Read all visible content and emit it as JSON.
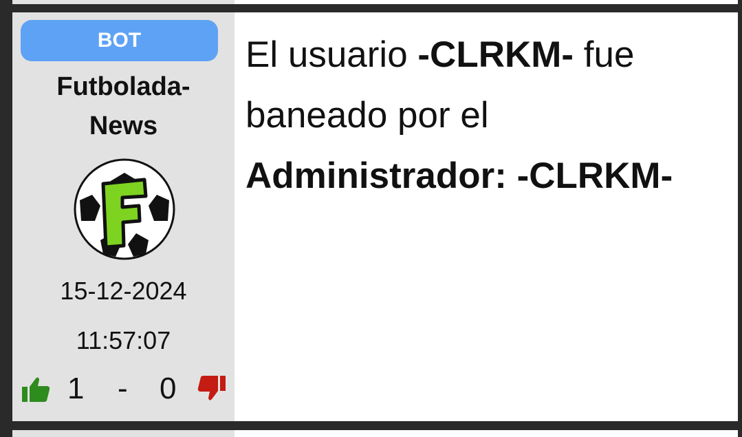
{
  "post": {
    "badge": "BOT",
    "author_line1": "Futbolada-",
    "author_line2": "News",
    "avatar_icon": "soccer-ball-letter-f-icon",
    "avatar_letter": "F",
    "date": "15-12-2024",
    "time": "11:57:07",
    "likes": "1",
    "vote_separator": "-",
    "dislikes": "0",
    "message": {
      "part1": "El usuario ",
      "user": "-CLRKM-",
      "part2": " fue baneado por el ",
      "admin": "Administrador: -CLRKM-"
    }
  },
  "colors": {
    "badge": "#5ea2f5",
    "sidebar": "#e2e2e2",
    "thumb_up": "#2e8b1e",
    "thumb_down": "#c41b12",
    "frame": "#2a2a2a"
  }
}
